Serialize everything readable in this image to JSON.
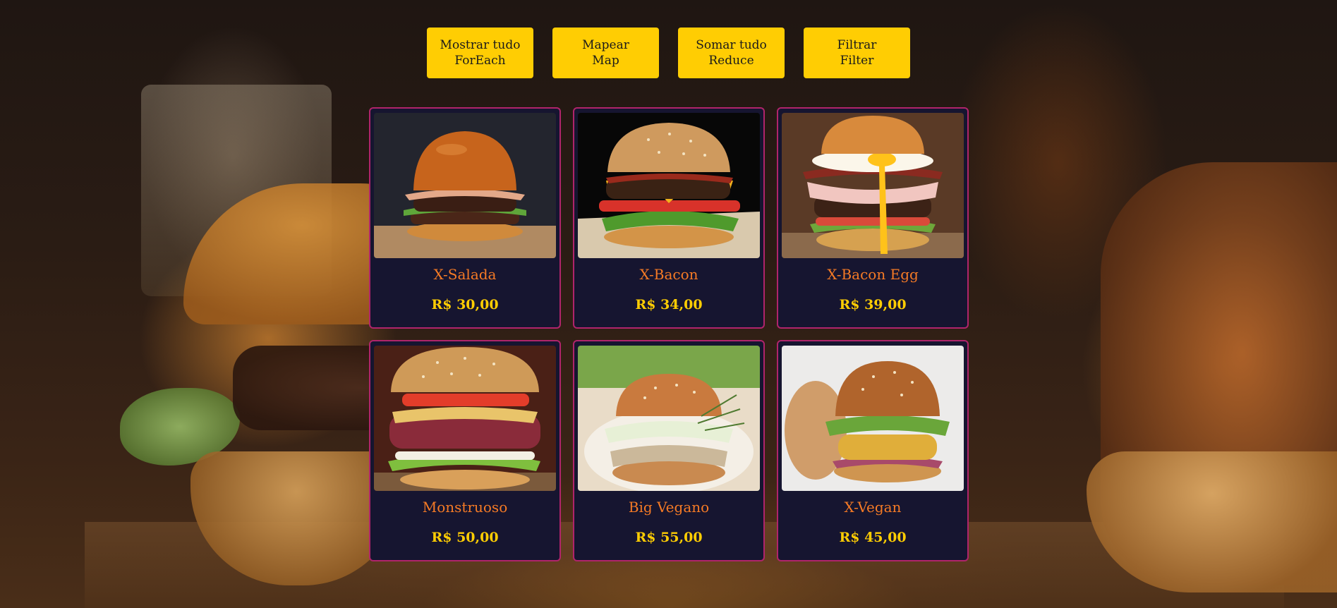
{
  "toolbar": {
    "buttons": [
      {
        "line1": "Mostrar tudo",
        "line2": "ForEach"
      },
      {
        "line1": "Mapear",
        "line2": "Map"
      },
      {
        "line1": "Somar tudo",
        "line2": "Reduce"
      },
      {
        "line1": "Filtrar",
        "line2": "Filter"
      }
    ]
  },
  "menu": {
    "items": [
      {
        "name": "X-Salada",
        "price": "R$ 30,00",
        "image": "burger-photo"
      },
      {
        "name": "X-Bacon",
        "price": "R$ 34,00",
        "image": "burger-photo"
      },
      {
        "name": "X-Bacon Egg",
        "price": "R$ 39,00",
        "image": "burger-photo"
      },
      {
        "name": "Monstruoso",
        "price": "R$ 50,00",
        "image": "burger-photo"
      },
      {
        "name": "Big Vegano",
        "price": "R$ 55,00",
        "image": "burger-photo"
      },
      {
        "name": "X-Vegan",
        "price": "R$ 45,00",
        "image": "burger-photo"
      }
    ]
  },
  "colors": {
    "button": "#ffcd03",
    "card_background": "#161530",
    "card_border": "#b0246b",
    "item_name": "#f57a25",
    "item_price": "#ffcd03"
  }
}
